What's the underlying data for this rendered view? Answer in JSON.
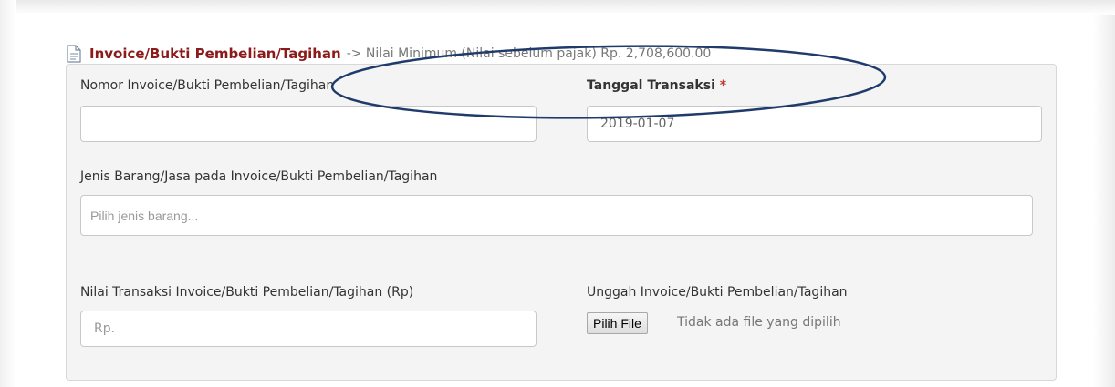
{
  "header": {
    "title": "Invoice/Bukti Pembelian/Tagihan",
    "subtitle": "-> Nilai Minimum (Nilai sebelum pajak) Rp. 2,708,600.00"
  },
  "form": {
    "nomor_invoice": {
      "label": "Nomor Invoice/Bukti Pembelian/Tagihan",
      "value": ""
    },
    "tanggal_transaksi": {
      "label": "Tanggal Transaksi",
      "required_mark": "*",
      "value": "2019-01-07"
    },
    "jenis_barang": {
      "label": "Jenis Barang/Jasa pada Invoice/Bukti Pembelian/Tagihan",
      "placeholder": "Pilih jenis barang..."
    },
    "nilai_transaksi": {
      "label": "Nilai Transaksi Invoice/Bukti Pembelian/Tagihan (Rp)",
      "placeholder": "Rp."
    },
    "unggah_invoice": {
      "label": "Unggah Invoice/Bukti Pembelian/Tagihan",
      "button_label": "Pilih File",
      "status": "Tidak ada file yang dipilih"
    }
  },
  "colors": {
    "title": "#8b1a1a",
    "required": "#c0392b",
    "annotation": "#1f3b6b",
    "panel_bg": "#f4f4f4"
  },
  "icons": {
    "title_icon": "document-icon"
  }
}
